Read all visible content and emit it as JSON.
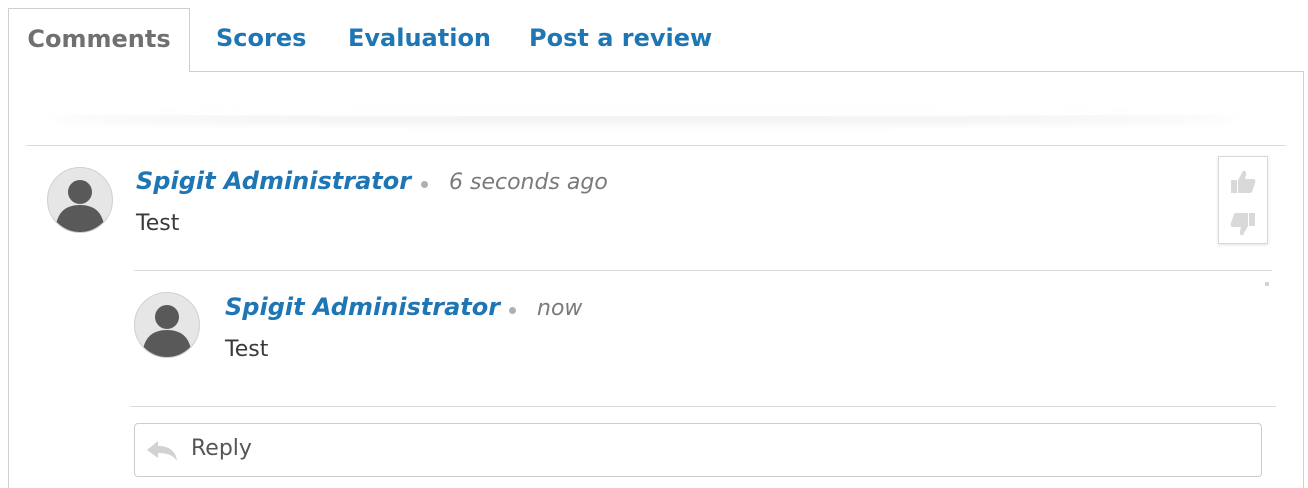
{
  "tabs": [
    {
      "label": "Comments",
      "active": true
    },
    {
      "label": "Scores",
      "active": false
    },
    {
      "label": "Evaluation",
      "active": false
    },
    {
      "label": "Post a review",
      "active": false
    }
  ],
  "comments": [
    {
      "author": "Spigit Administrator",
      "time": "6 seconds ago",
      "text": "Test",
      "avatar_icon": "default-user-avatar",
      "replies": [
        {
          "author": "Spigit Administrator",
          "time": "now",
          "text": "Test",
          "avatar_icon": "default-user-avatar"
        }
      ]
    }
  ],
  "vote": {
    "up_icon": "thumbs-up-icon",
    "down_icon": "thumbs-down-icon"
  },
  "reply": {
    "label": "Reply",
    "icon": "reply-arrow-icon"
  },
  "colors": {
    "link": "#1f76b5",
    "active_tab_text": "#707070",
    "muted_text": "#7a7a7a",
    "border": "#cfcfcf"
  }
}
